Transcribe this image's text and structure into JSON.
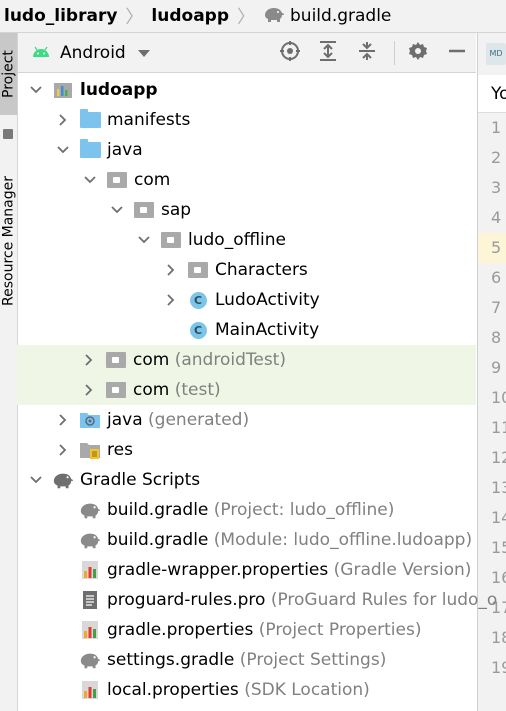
{
  "breadcrumb": [
    {
      "label": "ludo_library"
    },
    {
      "label": "ludoapp"
    },
    {
      "label": "build.gradle",
      "icon": "gradle-elephant-icon"
    }
  ],
  "toolstrip": {
    "project_tab": "Project",
    "resource_tab": "Resource Manager"
  },
  "toolbar": {
    "view_label": "Android",
    "icons": [
      "select-opened-file-icon",
      "expand-all-icon",
      "collapse-all-icon",
      "settings-icon",
      "hide-icon"
    ]
  },
  "editor": {
    "tab_label": "MD",
    "header_text": "Yo",
    "line_numbers": [
      "1",
      "2",
      "3",
      "4",
      "5",
      "6",
      "7",
      "8",
      "9",
      "10",
      "11",
      "12",
      "13",
      "14",
      "15",
      "16",
      "17",
      "18",
      "19"
    ],
    "highlight_line": "5"
  },
  "tree": [
    {
      "label": "ludoapp",
      "depth": 0,
      "arrow": "open",
      "icon": "module-icon",
      "bold": true
    },
    {
      "label": "manifests",
      "depth": 1,
      "arrow": "closed",
      "icon": "folder-icon"
    },
    {
      "label": "java",
      "depth": 1,
      "arrow": "open",
      "icon": "folder-icon"
    },
    {
      "label": "com",
      "depth": 2,
      "arrow": "open",
      "icon": "package-icon"
    },
    {
      "label": "sap",
      "depth": 3,
      "arrow": "open",
      "icon": "package-icon"
    },
    {
      "label": "ludo_offline",
      "depth": 4,
      "arrow": "open",
      "icon": "package-icon"
    },
    {
      "label": "Characters",
      "depth": 5,
      "arrow": "closed",
      "icon": "package-icon"
    },
    {
      "label": "LudoActivity",
      "depth": 5,
      "arrow": "closed",
      "icon": "class-icon"
    },
    {
      "label": "MainActivity",
      "depth": 5,
      "arrow": "none",
      "icon": "class-icon"
    },
    {
      "label": "com",
      "suffix": "(androidTest)",
      "depth": 2,
      "arrow": "closed",
      "icon": "package-icon",
      "highlight": true
    },
    {
      "label": "com",
      "suffix": "(test)",
      "depth": 2,
      "arrow": "closed",
      "icon": "package-icon",
      "highlight": true
    },
    {
      "label": "java",
      "suffix": "(generated)",
      "depth": 1,
      "arrow": "closed",
      "icon": "generated-folder-icon"
    },
    {
      "label": "res",
      "depth": 1,
      "arrow": "closed",
      "icon": "res-folder-icon"
    },
    {
      "label": "Gradle Scripts",
      "depth": 0,
      "arrow": "open",
      "icon": "gradle-icon"
    },
    {
      "label": "build.gradle",
      "suffix": "(Project: ludo_offline)",
      "depth": 1,
      "arrow": "none",
      "icon": "gradle-file-icon"
    },
    {
      "label": "build.gradle",
      "suffix": "(Module: ludo_offline.ludoapp)",
      "depth": 1,
      "arrow": "none",
      "icon": "gradle-file-icon"
    },
    {
      "label": "gradle-wrapper.properties",
      "suffix": "(Gradle Version)",
      "depth": 1,
      "arrow": "none",
      "icon": "properties-file-icon"
    },
    {
      "label": "proguard-rules.pro",
      "suffix": "(ProGuard Rules for ludo_o",
      "depth": 1,
      "arrow": "none",
      "icon": "text-file-icon"
    },
    {
      "label": "gradle.properties",
      "suffix": "(Project Properties)",
      "depth": 1,
      "arrow": "none",
      "icon": "properties-file-icon"
    },
    {
      "label": "settings.gradle",
      "suffix": "(Project Settings)",
      "depth": 1,
      "arrow": "none",
      "icon": "gradle-file-icon"
    },
    {
      "label": "local.properties",
      "suffix": "(SDK Location)",
      "depth": 1,
      "arrow": "none",
      "icon": "properties-file-icon"
    }
  ],
  "colors": {
    "highlight_row": "#eff6e6",
    "class_icon": "#7bc6e8",
    "folder_blue": "#7cc4ee",
    "gradle_gray": "#8a8a8a"
  }
}
